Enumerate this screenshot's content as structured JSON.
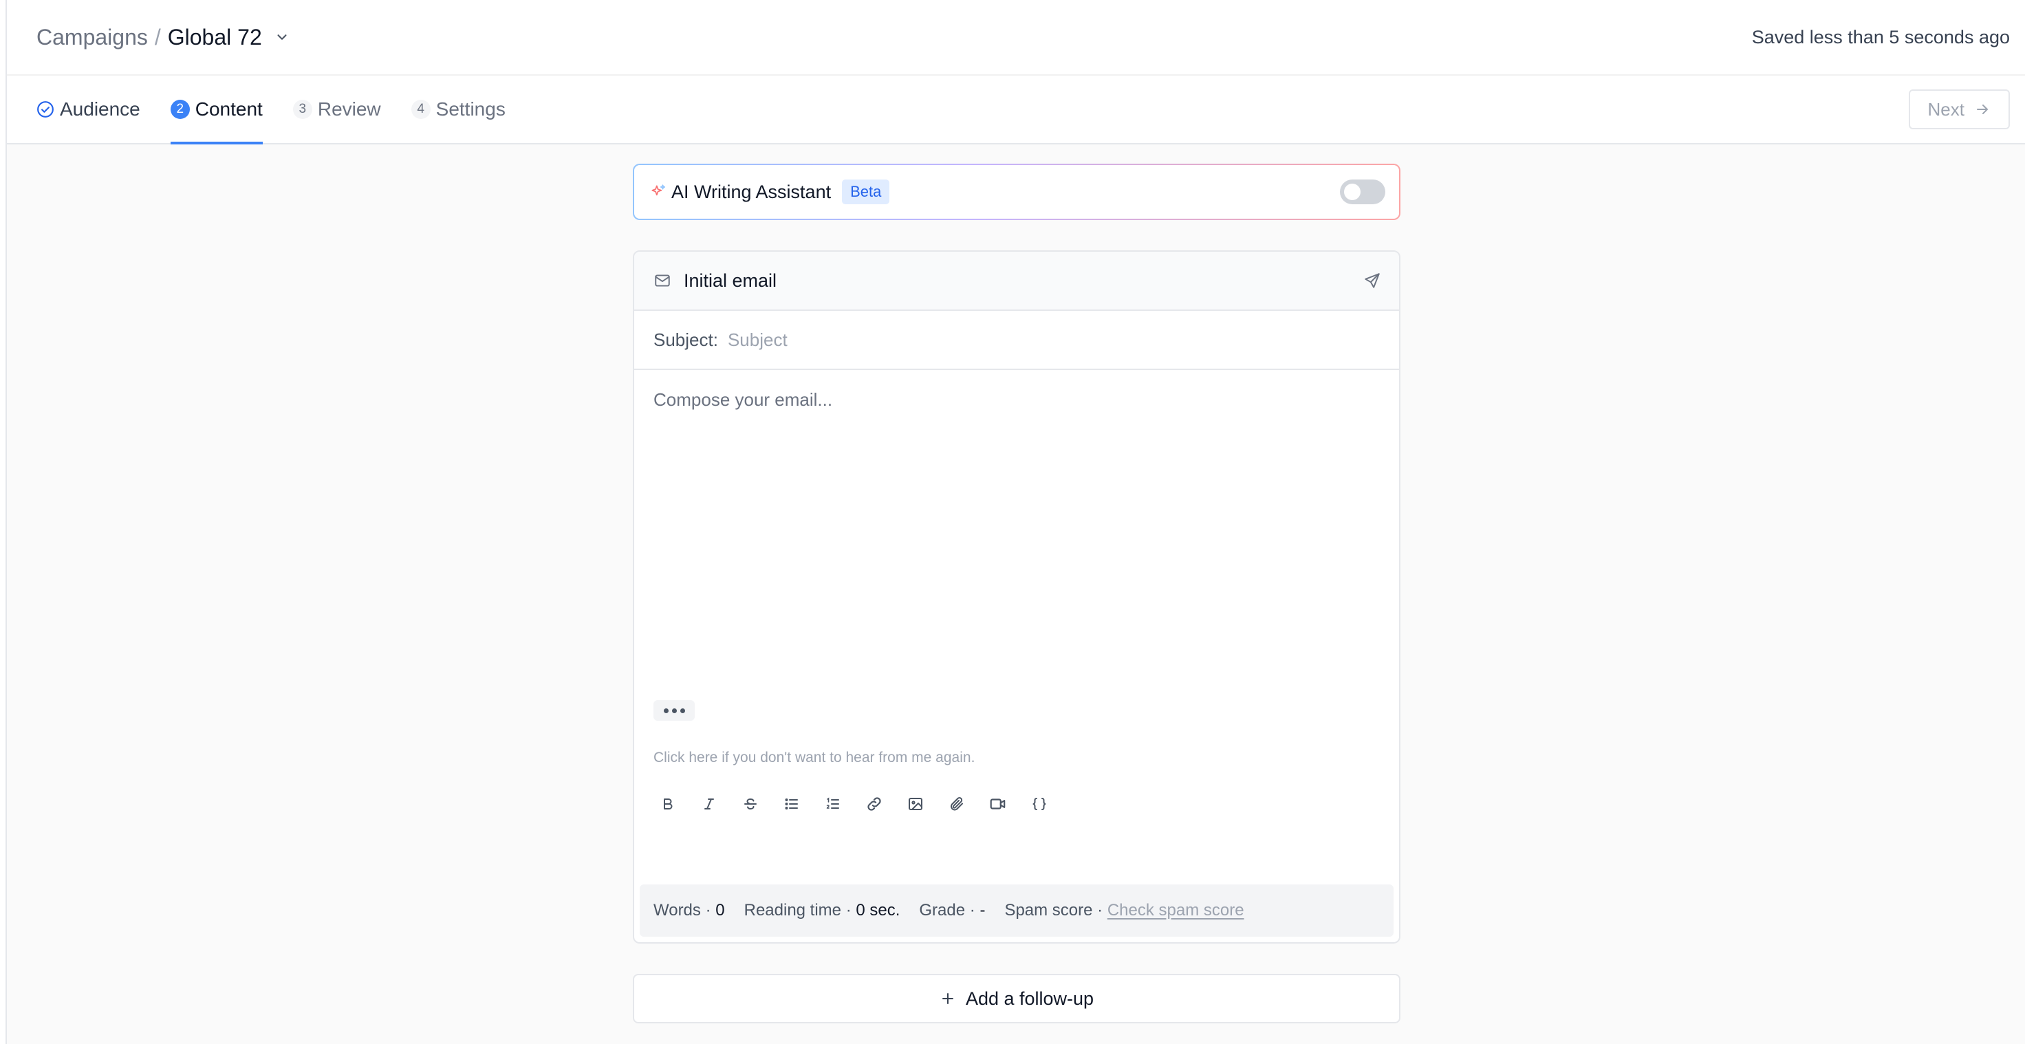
{
  "header": {
    "breadcrumb_root": "Campaigns",
    "breadcrumb_separator": "/",
    "campaign_name": "Global 72",
    "save_status": "Saved less than 5 seconds ago"
  },
  "tabs": [
    {
      "number": "",
      "label": "Audience",
      "state": "completed"
    },
    {
      "number": "2",
      "label": "Content",
      "state": "active"
    },
    {
      "number": "3",
      "label": "Review",
      "state": "pending"
    },
    {
      "number": "4",
      "label": "Settings",
      "state": "pending"
    }
  ],
  "next_button": {
    "label": "Next"
  },
  "ai_assistant": {
    "label": "AI Writing Assistant",
    "badge": "Beta",
    "enabled": false
  },
  "email": {
    "title": "Initial email",
    "subject_label": "Subject:",
    "subject_value": "",
    "subject_placeholder": "Subject",
    "body_placeholder": "Compose your email...",
    "unsubscribe_text": "Click here if you don't want to hear from me again.",
    "toolbar_icons": [
      "bold-icon",
      "italic-icon",
      "strikethrough-icon",
      "bullet-list-icon",
      "numbered-list-icon",
      "link-icon",
      "image-icon",
      "attachment-icon",
      "video-icon",
      "variables-icon"
    ],
    "stats": {
      "words_label": "Words ·",
      "words_value": "0",
      "reading_label": "Reading time ·",
      "reading_value": "0 sec.",
      "grade_label": "Grade ·",
      "grade_value": "-",
      "spam_label": "Spam score ·",
      "spam_link": "Check spam score"
    }
  },
  "followup_button": {
    "label": "Add a follow-up"
  },
  "colors": {
    "accent": "#3b82f6",
    "border": "#e5e7eb",
    "background": "#fafafa"
  }
}
